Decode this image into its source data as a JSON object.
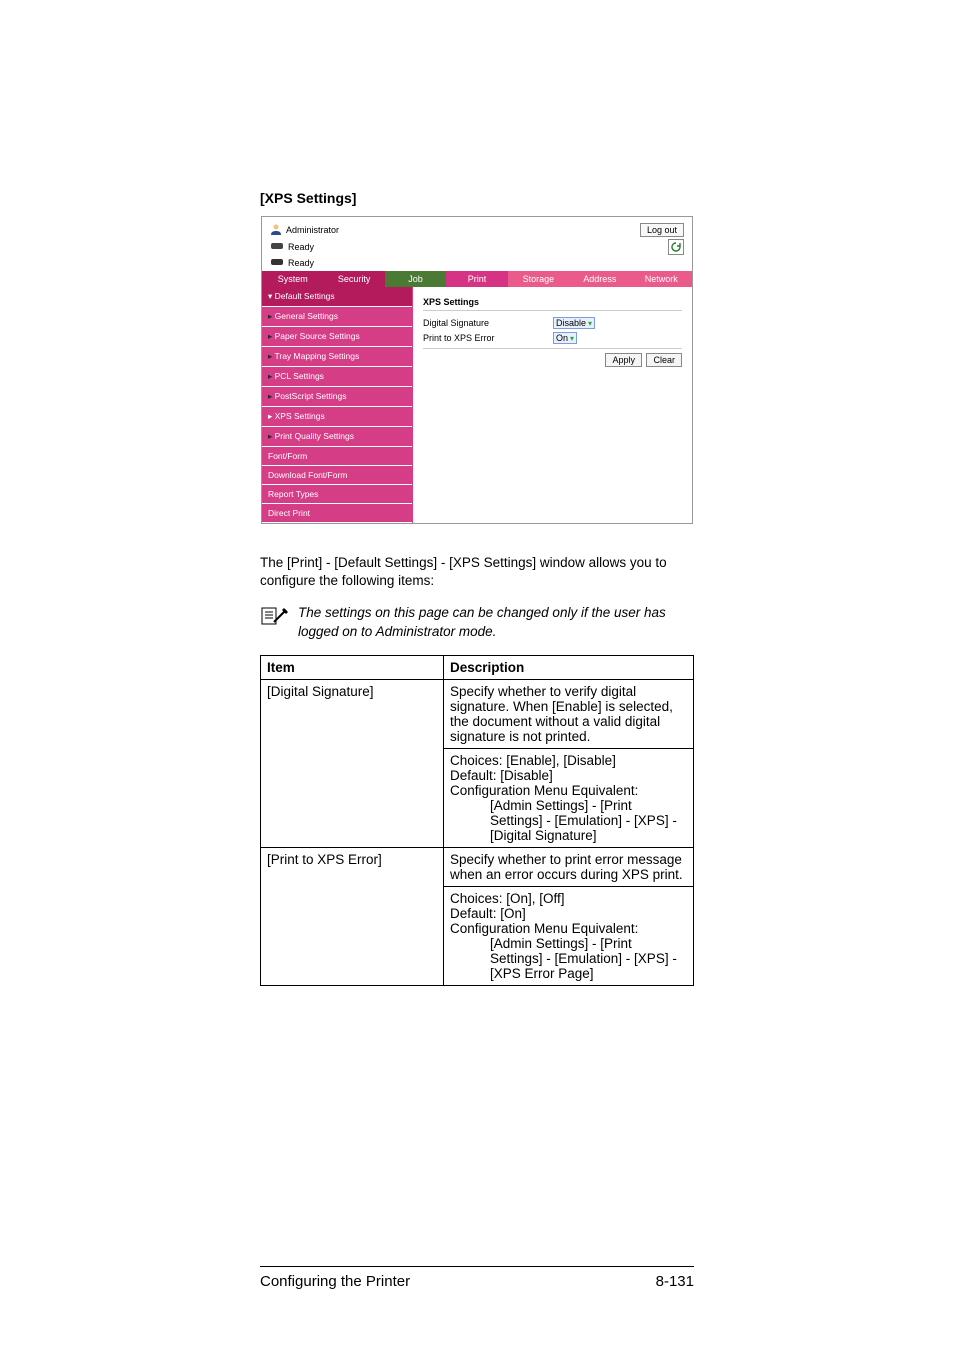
{
  "section_heading": "[XPS Settings]",
  "ui": {
    "admin_label": "Administrator",
    "logout": "Log out",
    "status1": "Ready",
    "status2": "Ready",
    "tabs": {
      "system": "System",
      "security": "Security",
      "job": "Job",
      "print": "Print",
      "storage": "Storage",
      "address": "Address",
      "network": "Network"
    },
    "side": [
      "Default Settings",
      "General Settings",
      "Paper Source Settings",
      "Tray Mapping Settings",
      "PCL Settings",
      "PostScript Settings",
      "XPS Settings",
      "Print Quality Settings",
      "Font/Form",
      "Download Font/Form",
      "Report Types",
      "Direct Print"
    ],
    "main_title": "XPS Settings",
    "row1_label": "Digital Signature",
    "row1_value": "Disable",
    "row2_label": "Print to XPS Error",
    "row2_value": "On",
    "apply": "Apply",
    "clear": "Clear"
  },
  "para1": "The [Print] - [Default Settings] - [XPS Settings] window allows you to configure the following items:",
  "note": "The settings on this page can be changed only if the user has logged on to Administrator mode.",
  "table": {
    "h_item": "Item",
    "h_desc": "Description",
    "r1_item": "[Digital Signature]",
    "r1_desc_a": "Specify whether to verify digital signature. When [Enable] is selected, the document without a valid digital signature is not printed.",
    "r1_desc_b1": "Choices: [Enable], [Disable]",
    "r1_desc_b2": "Default: [Disable]",
    "r1_desc_b3": "Configuration Menu Equivalent:",
    "r1_desc_b4": "[Admin Settings] - [Print Settings] - [Emulation] - [XPS] - [Digital Signature]",
    "r2_item": "[Print to XPS Error]",
    "r2_desc_a": "Specify whether to print error message when an error occurs during XPS print.",
    "r2_desc_b1": "Choices: [On], [Off]",
    "r2_desc_b2": "Default: [On]",
    "r2_desc_b3": "Configuration Menu Equivalent:",
    "r2_desc_b4": "[Admin Settings] - [Print Settings] - [Emulation] - [XPS] - [XPS Error Page]"
  },
  "footer_left": "Configuring the Printer",
  "footer_right": "8-131"
}
